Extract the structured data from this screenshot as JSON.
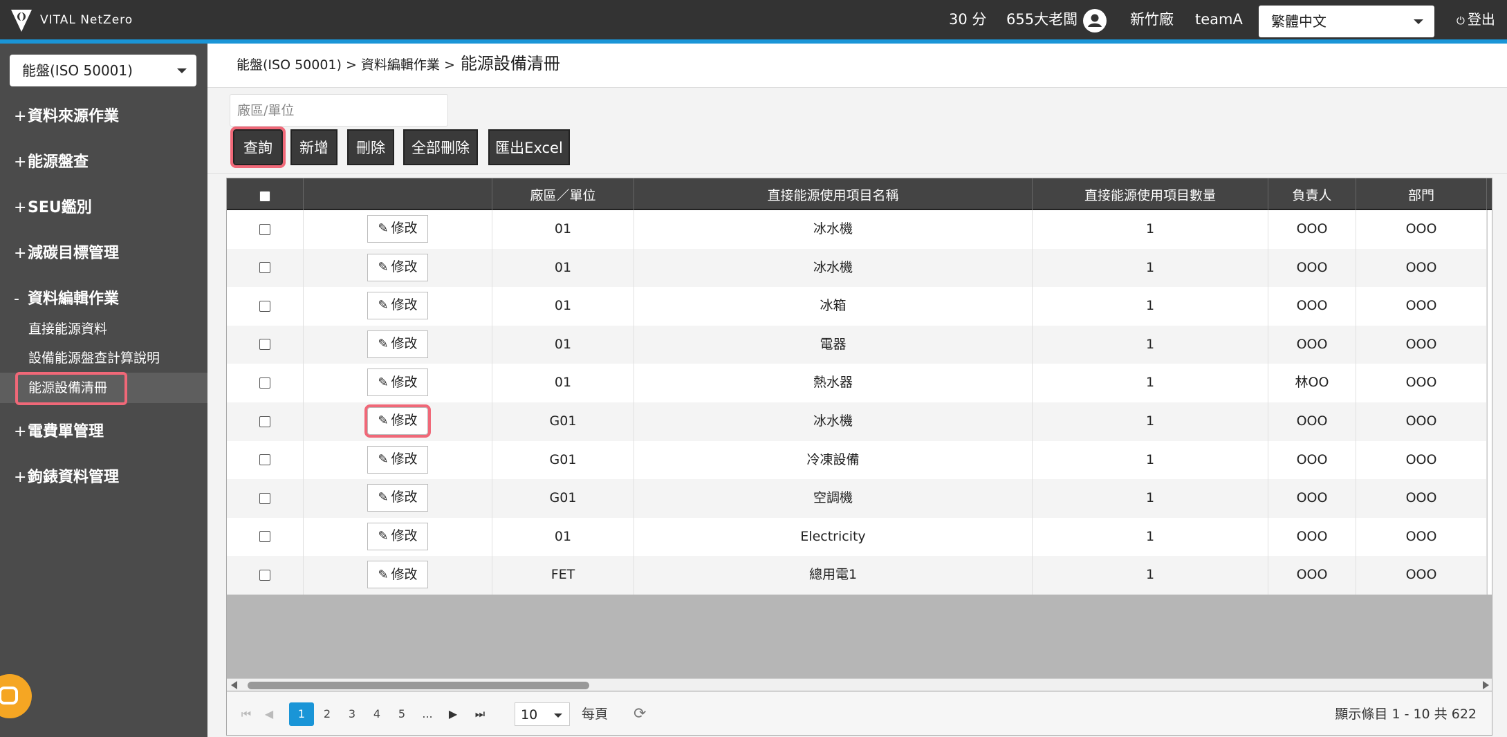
{
  "header": {
    "logo_text": "VITAL NetZero",
    "score": "30 分",
    "user_name": "655大老闆",
    "factory": "新竹廠",
    "team": "teamA",
    "language": "繁體中文",
    "logout_label": "登出"
  },
  "sidebar": {
    "module_select": "能盤(ISO 50001)",
    "groups": [
      {
        "sign": "+",
        "label": "資料來源作業"
      },
      {
        "sign": "+",
        "label": "能源盤查"
      },
      {
        "sign": "+",
        "label": "SEU鑑別"
      },
      {
        "sign": "+",
        "label": "減碳目標管理"
      },
      {
        "sign": "-",
        "label": "資料編輯作業"
      },
      {
        "sign": "+",
        "label": "電費單管理"
      },
      {
        "sign": "+",
        "label": "鉤錶資料管理"
      }
    ],
    "sub_items": [
      {
        "label": "直接能源資料"
      },
      {
        "label": "設備能源盤查計算說明"
      },
      {
        "label": "能源設備清冊"
      }
    ]
  },
  "breadcrumb": {
    "path": "能盤(ISO 50001) > 資料編輯作業 >",
    "current": "能源設備清冊"
  },
  "filter": {
    "placeholder": "廠區/單位"
  },
  "toolbar": {
    "query": "查詢",
    "add": "新增",
    "delete": "刪除",
    "delete_all": "全部刪除",
    "export_excel": "匯出Excel"
  },
  "grid": {
    "columns": [
      "",
      "",
      "廠區／單位",
      "直接能源使用項目名稱",
      "直接能源使用項目數量",
      "負責人",
      "部門"
    ],
    "edit_label": "修改",
    "rows": [
      {
        "unit": "01",
        "item": "冰水機",
        "qty": "1",
        "owner": "OOO",
        "dept": "OOO"
      },
      {
        "unit": "01",
        "item": "冰水機",
        "qty": "1",
        "owner": "OOO",
        "dept": "OOO"
      },
      {
        "unit": "01",
        "item": "冰箱",
        "qty": "1",
        "owner": "OOO",
        "dept": "OOO"
      },
      {
        "unit": "01",
        "item": "電器",
        "qty": "1",
        "owner": "OOO",
        "dept": "OOO"
      },
      {
        "unit": "01",
        "item": "熱水器",
        "qty": "1",
        "owner": "林OO",
        "dept": "OOO"
      },
      {
        "unit": "G01",
        "item": "冰水機",
        "qty": "1",
        "owner": "OOO",
        "dept": "OOO"
      },
      {
        "unit": "G01",
        "item": "冷凍設備",
        "qty": "1",
        "owner": "OOO",
        "dept": "OOO"
      },
      {
        "unit": "G01",
        "item": "空調機",
        "qty": "1",
        "owner": "OOO",
        "dept": "OOO"
      },
      {
        "unit": "01",
        "item": "Electricity",
        "qty": "1",
        "owner": "OOO",
        "dept": "OOO"
      },
      {
        "unit": "FET",
        "item": "總用電1",
        "qty": "1",
        "owner": "OOO",
        "dept": "OOO"
      }
    ]
  },
  "pager": {
    "pages": [
      "1",
      "2",
      "3",
      "4",
      "5",
      "..."
    ],
    "page_size": "10",
    "per_page_label": "每頁",
    "summary": "顯示條目 1 - 10 共 622"
  },
  "colors": {
    "topbar": "#333333",
    "accent": "#1a95d7",
    "sidebar": "#4b4b4b",
    "highlight": "#f06878",
    "chat": "#f5a623"
  }
}
